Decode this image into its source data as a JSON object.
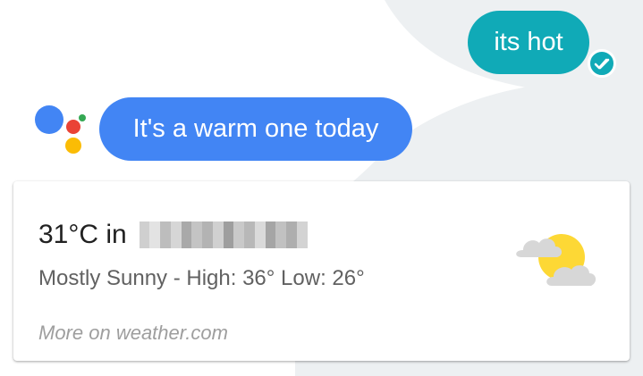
{
  "conversation": {
    "user_message": "its hot",
    "assistant_message": "It's a warm one today"
  },
  "weather_card": {
    "temperature_prefix": "31°C in",
    "location": "",
    "condition_line": "Mostly Sunny - High: 36° Low: 26°",
    "more_link": "More on weather.com",
    "icon": "partly-sunny-icon"
  },
  "colors": {
    "user_bubble": "#10aab7",
    "assistant_bubble": "#4285f4",
    "background_shape": "#eceff1"
  }
}
